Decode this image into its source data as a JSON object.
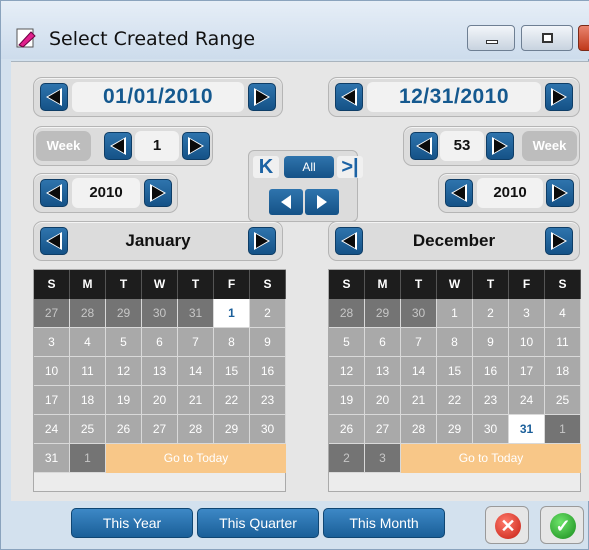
{
  "window": {
    "title": "Select Created Range"
  },
  "start": {
    "date": "01/01/2010",
    "week_label": "Week",
    "week": "1",
    "year": "2010",
    "month": "January",
    "days": [
      {
        "d": "27",
        "t": "other"
      },
      {
        "d": "28",
        "t": "other"
      },
      {
        "d": "29",
        "t": "other"
      },
      {
        "d": "30",
        "t": "other"
      },
      {
        "d": "31",
        "t": "other"
      },
      {
        "d": "1",
        "t": "sel"
      },
      {
        "d": "2",
        "t": "cur"
      },
      {
        "d": "3",
        "t": "cur"
      },
      {
        "d": "4",
        "t": "cur"
      },
      {
        "d": "5",
        "t": "cur"
      },
      {
        "d": "6",
        "t": "cur"
      },
      {
        "d": "7",
        "t": "cur"
      },
      {
        "d": "8",
        "t": "cur"
      },
      {
        "d": "9",
        "t": "cur"
      },
      {
        "d": "10",
        "t": "cur"
      },
      {
        "d": "11",
        "t": "cur"
      },
      {
        "d": "12",
        "t": "cur"
      },
      {
        "d": "13",
        "t": "cur"
      },
      {
        "d": "14",
        "t": "cur"
      },
      {
        "d": "15",
        "t": "cur"
      },
      {
        "d": "16",
        "t": "cur"
      },
      {
        "d": "17",
        "t": "cur"
      },
      {
        "d": "18",
        "t": "cur"
      },
      {
        "d": "19",
        "t": "cur"
      },
      {
        "d": "20",
        "t": "cur"
      },
      {
        "d": "21",
        "t": "cur"
      },
      {
        "d": "22",
        "t": "cur"
      },
      {
        "d": "23",
        "t": "cur"
      },
      {
        "d": "24",
        "t": "cur"
      },
      {
        "d": "25",
        "t": "cur"
      },
      {
        "d": "26",
        "t": "cur"
      },
      {
        "d": "27",
        "t": "cur"
      },
      {
        "d": "28",
        "t": "cur"
      },
      {
        "d": "29",
        "t": "cur"
      },
      {
        "d": "30",
        "t": "cur"
      },
      {
        "d": "31",
        "t": "cur"
      },
      {
        "d": "1",
        "t": "other"
      }
    ],
    "goto_today": "Go to Today"
  },
  "end": {
    "date": "12/31/2010",
    "week_label": "Week",
    "week": "53",
    "year": "2010",
    "month": "December",
    "days": [
      {
        "d": "28",
        "t": "other"
      },
      {
        "d": "29",
        "t": "other"
      },
      {
        "d": "30",
        "t": "other"
      },
      {
        "d": "1",
        "t": "cur"
      },
      {
        "d": "2",
        "t": "cur"
      },
      {
        "d": "3",
        "t": "cur"
      },
      {
        "d": "4",
        "t": "cur"
      },
      {
        "d": "5",
        "t": "cur"
      },
      {
        "d": "6",
        "t": "cur"
      },
      {
        "d": "7",
        "t": "cur"
      },
      {
        "d": "8",
        "t": "cur"
      },
      {
        "d": "9",
        "t": "cur"
      },
      {
        "d": "10",
        "t": "cur"
      },
      {
        "d": "11",
        "t": "cur"
      },
      {
        "d": "12",
        "t": "cur"
      },
      {
        "d": "13",
        "t": "cur"
      },
      {
        "d": "14",
        "t": "cur"
      },
      {
        "d": "15",
        "t": "cur"
      },
      {
        "d": "16",
        "t": "cur"
      },
      {
        "d": "17",
        "t": "cur"
      },
      {
        "d": "18",
        "t": "cur"
      },
      {
        "d": "19",
        "t": "cur"
      },
      {
        "d": "20",
        "t": "cur"
      },
      {
        "d": "21",
        "t": "cur"
      },
      {
        "d": "22",
        "t": "cur"
      },
      {
        "d": "23",
        "t": "cur"
      },
      {
        "d": "24",
        "t": "cur"
      },
      {
        "d": "25",
        "t": "cur"
      },
      {
        "d": "26",
        "t": "cur"
      },
      {
        "d": "27",
        "t": "cur"
      },
      {
        "d": "28",
        "t": "cur"
      },
      {
        "d": "29",
        "t": "cur"
      },
      {
        "d": "30",
        "t": "cur"
      },
      {
        "d": "31",
        "t": "sel"
      },
      {
        "d": "1",
        "t": "other"
      },
      {
        "d": "2",
        "t": "other"
      },
      {
        "d": "3",
        "t": "other"
      }
    ],
    "goto_today": "Go to Today"
  },
  "weekdays": [
    "S",
    "M",
    "T",
    "W",
    "T",
    "F",
    "S"
  ],
  "center": {
    "all_label": "All",
    "first_icon": "skip-to-first-icon",
    "last_icon": "skip-to-last-icon"
  },
  "footer": {
    "this_year": "This Year",
    "this_quarter": "This Quarter",
    "this_month": "This Month",
    "cancel_icon": "cancel-icon",
    "ok_icon": "checkmark-icon"
  },
  "colors": {
    "accent": "#15598f",
    "header_bg": "#1d1d1d",
    "goto_bg": "#f8c788",
    "current_day": "#a9a9a9",
    "other_day": "#747474"
  }
}
